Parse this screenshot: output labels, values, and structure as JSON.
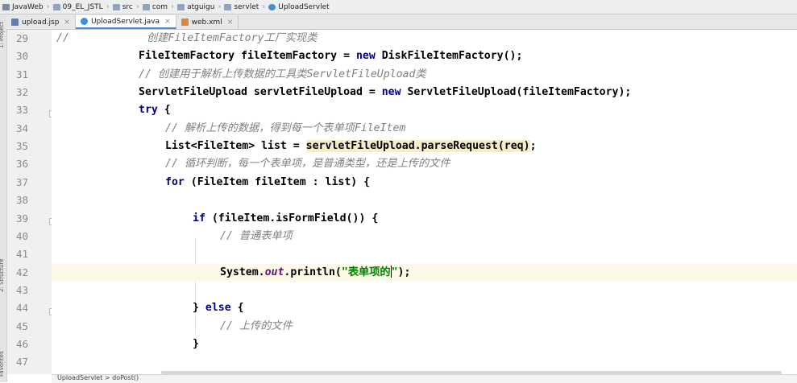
{
  "breadcrumb": [
    {
      "label": "JavaWeb",
      "icon": "project-icon"
    },
    {
      "label": "09_EL_JSTL",
      "icon": "folder-icon"
    },
    {
      "label": "src",
      "icon": "folder-icon"
    },
    {
      "label": "com",
      "icon": "folder-icon"
    },
    {
      "label": "atguigu",
      "icon": "folder-icon"
    },
    {
      "label": "servlet",
      "icon": "folder-icon"
    },
    {
      "label": "UploadServlet",
      "icon": "class-icon"
    }
  ],
  "tabs": [
    {
      "label": "upload.jsp",
      "icon": "jsp-file-icon",
      "active": false
    },
    {
      "label": "UploadServlet.java",
      "icon": "java-class-icon",
      "active": true
    },
    {
      "label": "web.xml",
      "icon": "xml-file-icon",
      "active": false
    }
  ],
  "tab_close_glyph": "×",
  "left_strip_labels": [
    "1: Project",
    "2: Structure",
    "Favorites"
  ],
  "line_numbers": [
    "29",
    "30",
    "31",
    "32",
    "33",
    "34",
    "35",
    "36",
    "37",
    "38",
    "39",
    "40",
    "41",
    "42",
    "43",
    "44",
    "45",
    "46",
    "47"
  ],
  "code": {
    "l29_comment_prefix": "//",
    "l29_comment_text": "创建FileItemFactory工厂实现类",
    "l30_a": "FileItemFactory fileItemFactory = ",
    "l30_kw": "new",
    "l30_b": " DiskFileItemFactory();",
    "l31_comment": "// 创建用于解析上传数据的工具类ServletFileUpload类",
    "l32_a": "ServletFileUpload servletFileUpload = ",
    "l32_kw": "new",
    "l32_b": " ServletFileUpload(fileItemFactory);",
    "l33_kw": "try",
    "l33_b": " {",
    "l34_comment": "// 解析上传的数据，得到每一个表单项FileItem",
    "l35_a": "List<FileItem> list = ",
    "l35_hl": "servletFileUpload.parseRequest(req)",
    "l35_b": ";",
    "l36_comment": "// 循环判断，每一个表单项，是普通类型，还是上传的文件",
    "l37_kw": "for",
    "l37_b": " (FileItem fileItem : list) {",
    "l39_kw": "if",
    "l39_b": " (fileItem.isFormField()) {",
    "l40_comment": "// 普通表单项",
    "l42_a": "System.",
    "l42_field": "out",
    "l42_b": ".println(",
    "l42_str": "\"表单项的",
    "l42_str_end": "\"",
    "l42_c": ");",
    "l44_a": "} ",
    "l44_kw": "else",
    "l44_b": " {",
    "l45_comment": "// 上传的文件",
    "l46_a": "}"
  },
  "status": {
    "breadcrumb": "UploadServlet  >  doPost()"
  },
  "colors": {
    "keyword": "#000080",
    "comment": "#808080",
    "string": "#008000",
    "static_field": "#660e7a",
    "current_line": "#fcfae6",
    "usage_highlight": "#f7edc9"
  }
}
